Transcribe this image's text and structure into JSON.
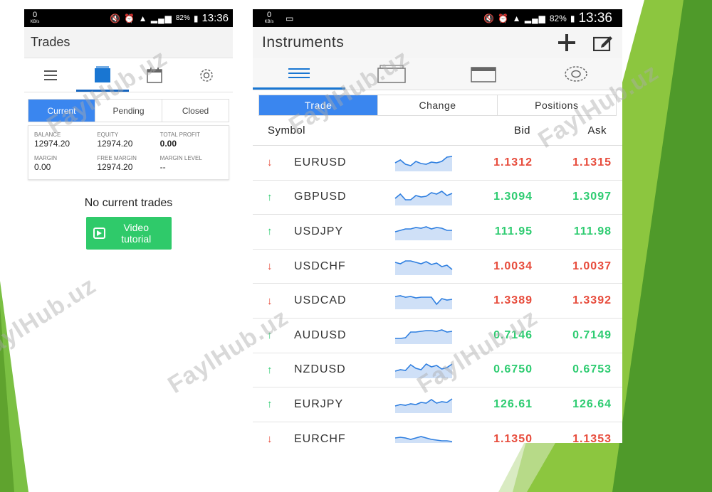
{
  "colors": {
    "accent": "#3a86ef",
    "up": "#2ecc71",
    "down": "#e74c3c",
    "green_bg": "#7bc043",
    "button_green": "#2fca6a"
  },
  "status_bar_left": {
    "speed": "0",
    "unit": "KB/s",
    "time": "13:36",
    "battery": "82%"
  },
  "status_bar_right": {
    "speed": "0",
    "unit": "KB/s",
    "time": "13:36",
    "battery": "82%"
  },
  "trades": {
    "title": "Trades",
    "tabs": [
      "menu-icon",
      "trades-icon",
      "calendar-icon",
      "settings-icon"
    ],
    "segments": [
      "Current",
      "Pending",
      "Closed"
    ],
    "account": {
      "balance_label": "BALANCE",
      "balance": "12974.20",
      "equity_label": "EQUITY",
      "equity": "12974.20",
      "total_profit_label": "TOTAL PROFIT",
      "total_profit": "0.00",
      "margin_label": "MARGIN",
      "margin": "0.00",
      "free_margin_label": "FREE MARGIN",
      "free_margin": "12974.20",
      "margin_level_label": "MARGIN LEVEL",
      "margin_level": "--"
    },
    "empty_text": "No current trades",
    "video_button": "Video tutorial"
  },
  "instruments": {
    "title": "Instruments",
    "actions": [
      "add-icon",
      "edit-icon"
    ],
    "segments": [
      "Trade",
      "Change",
      "Positions"
    ],
    "headers": {
      "symbol": "Symbol",
      "bid": "Bid",
      "ask": "Ask"
    },
    "rows": [
      {
        "dir": "down",
        "symbol": "EURUSD",
        "bid": "1.1312",
        "ask": "1.1315"
      },
      {
        "dir": "up",
        "symbol": "GBPUSD",
        "bid": "1.3094",
        "ask": "1.3097"
      },
      {
        "dir": "up",
        "symbol": "USDJPY",
        "bid": "111.95",
        "ask": "111.98"
      },
      {
        "dir": "down",
        "symbol": "USDCHF",
        "bid": "1.0034",
        "ask": "1.0037"
      },
      {
        "dir": "down",
        "symbol": "USDCAD",
        "bid": "1.3389",
        "ask": "1.3392"
      },
      {
        "dir": "up",
        "symbol": "AUDUSD",
        "bid": "0.7146",
        "ask": "0.7149"
      },
      {
        "dir": "up",
        "symbol": "NZDUSD",
        "bid": "0.6750",
        "ask": "0.6753"
      },
      {
        "dir": "up",
        "symbol": "EURJPY",
        "bid": "126.61",
        "ask": "126.64"
      },
      {
        "dir": "down",
        "symbol": "EURCHF",
        "bid": "1.1350",
        "ask": "1.1353"
      }
    ]
  },
  "watermark": "FaylHub.uz"
}
